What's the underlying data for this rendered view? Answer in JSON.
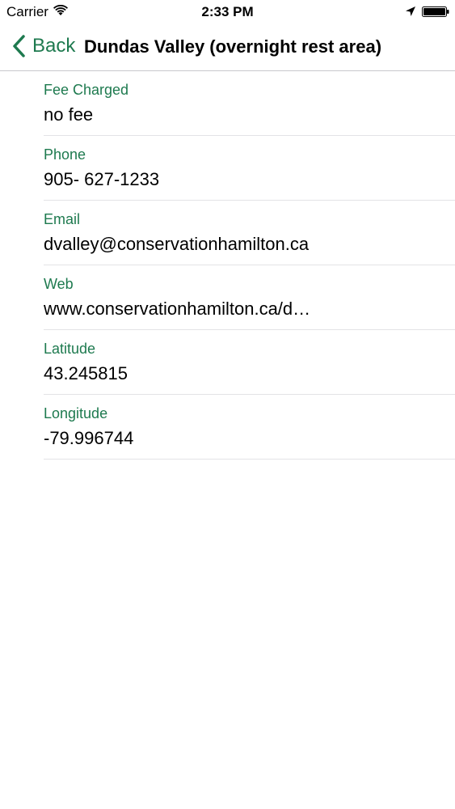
{
  "status_bar": {
    "carrier": "Carrier",
    "time": "2:33 PM"
  },
  "nav": {
    "back_label": "Back",
    "title": "Dundas Valley (overnight rest area)",
    "accent_color": "#1e7a4f"
  },
  "details": [
    {
      "label": "Fee Charged",
      "value": "no fee"
    },
    {
      "label": "Phone",
      "value": "905- 627-1233"
    },
    {
      "label": "Email",
      "value": "dvalley@conservationhamilton.ca"
    },
    {
      "label": "Web",
      "value": "www.conservationhamilton.ca/d…"
    },
    {
      "label": "Latitude",
      "value": "43.245815"
    },
    {
      "label": "Longitude",
      "value": "-79.996744"
    }
  ]
}
